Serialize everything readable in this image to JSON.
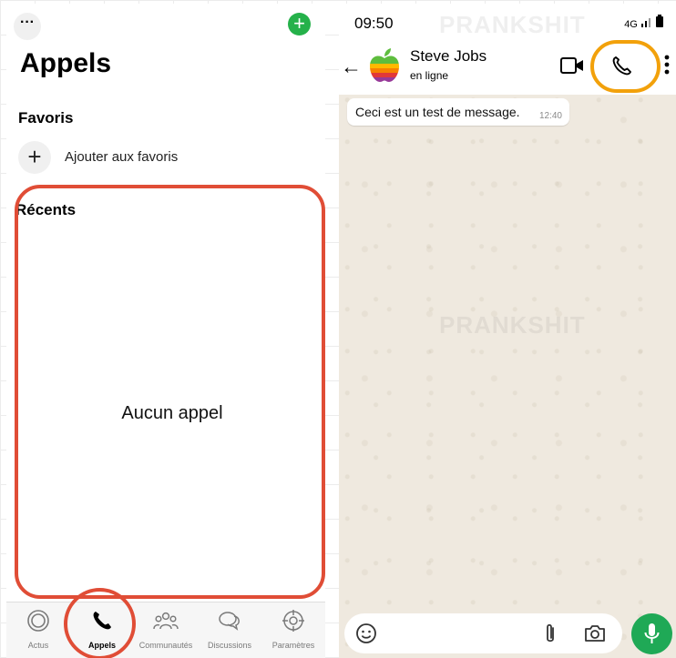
{
  "colors": {
    "accent_green": "#25b14a",
    "highlight_red": "#e04d36",
    "highlight_orange": "#f2a10b",
    "chat_background": "#efe9df"
  },
  "calls": {
    "menu_icon": "ellipsis-icon",
    "new_icon": "plus-icon",
    "title": "Appels",
    "favorites_heading": "Favoris",
    "add_favorite_label": "Ajouter aux favoris",
    "recents_heading": "Récents",
    "empty_label": "Aucun appel"
  },
  "tabbar": {
    "items": [
      {
        "label": "Actus",
        "icon": "status-icon",
        "active": false
      },
      {
        "label": "Appels",
        "icon": "phone-icon",
        "active": true
      },
      {
        "label": "Communautés",
        "icon": "communities-icon",
        "active": false
      },
      {
        "label": "Discussions",
        "icon": "chat-bubbles-icon",
        "active": false
      },
      {
        "label": "Paramètres",
        "icon": "gear-icon",
        "active": false
      }
    ]
  },
  "chat": {
    "status_time": "09:50",
    "network": "4G",
    "watermark": "PRANKSHIT",
    "contact_name": "Steve Jobs",
    "contact_status": "en ligne",
    "message": {
      "text": "Ceci est un test de message.",
      "time": "12:40"
    },
    "input_placeholder": ""
  }
}
